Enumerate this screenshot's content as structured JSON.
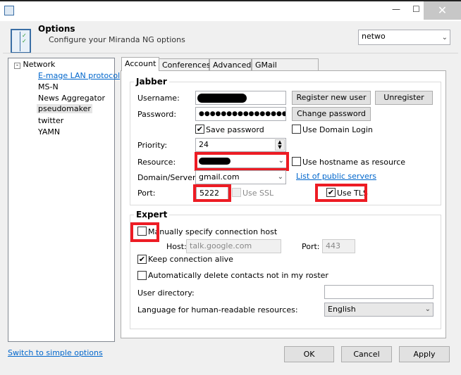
{
  "window": {
    "title": "Options",
    "subtitle": "Configure your Miranda NG options",
    "search_value": "netwo",
    "close": "✕",
    "minimize": "—",
    "maximize": "☐"
  },
  "tree": {
    "root": "Network",
    "items": [
      "E-mage LAN protocol",
      "MS-N",
      "News Aggregator",
      "pseudomaker",
      "twitter",
      "YAMN"
    ],
    "selected": "pseudomaker"
  },
  "tabs": [
    "Account",
    "Conferences",
    "Advanced",
    "GMail notifications"
  ],
  "jabber": {
    "title": "Jabber",
    "username_label": "Username:",
    "password_label": "Password:",
    "password_value": "●●●●●●●●●●●●●●●●",
    "register_btn": "Register new user",
    "unregister_btn": "Unregister",
    "change_password_btn": "Change password",
    "save_password": "Save password",
    "use_domain_login": "Use Domain Login",
    "priority_label": "Priority:",
    "priority_value": "24",
    "resource_label": "Resource:",
    "use_hostname": "Use hostname as resource",
    "domain_label": "Domain/Server:",
    "domain_value": "gmail.com",
    "public_servers_link": "List of public servers",
    "port_label": "Port:",
    "port_value": "5222",
    "use_ssl": "Use SSL",
    "use_tls": "Use TLS"
  },
  "expert": {
    "title": "Expert",
    "manual_host": "Manually specify connection host",
    "host_label": "Host:",
    "host_value": "talk.google.com",
    "port_label": "Port:",
    "port_value": "443",
    "keep_alive": "Keep connection alive",
    "auto_delete": "Automatically delete contacts not in my roster",
    "user_dir_label": "User directory:",
    "user_dir_value": "",
    "language_label": "Language for human-readable resources:",
    "language_value": "English"
  },
  "footer": {
    "simple_link": "Switch to simple options",
    "ok": "OK",
    "cancel": "Cancel",
    "apply": "Apply"
  },
  "colors": {
    "highlight": "#ed1c24",
    "link": "#0066cc"
  }
}
